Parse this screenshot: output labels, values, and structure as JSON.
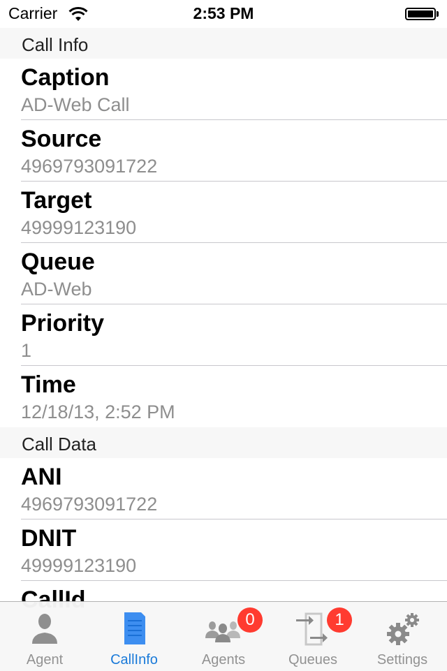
{
  "status_bar": {
    "carrier": "Carrier",
    "time": "2:53 PM",
    "wifi_icon": "wifi-icon",
    "battery_icon": "battery-icon",
    "battery_level": 1.0
  },
  "sections": [
    {
      "header": "Call Info",
      "rows": [
        {
          "title": "Caption",
          "value": "AD-Web Call"
        },
        {
          "title": "Source",
          "value": "4969793091722"
        },
        {
          "title": "Target",
          "value": "49999123190"
        },
        {
          "title": "Queue",
          "value": "AD-Web"
        },
        {
          "title": "Priority",
          "value": "1"
        },
        {
          "title": "Time",
          "value": "12/18/13, 2:52 PM"
        }
      ]
    },
    {
      "header": "Call Data",
      "rows": [
        {
          "title": "ANI",
          "value": "4969793091722"
        },
        {
          "title": "DNIT",
          "value": "49999123190"
        },
        {
          "title": "CallId",
          "value": ""
        }
      ]
    }
  ],
  "tab_bar": {
    "active": "CallInfo",
    "accent_color": "#1a7ad9",
    "tabs": [
      {
        "label": "Agent",
        "icon": "person-icon",
        "badge": null
      },
      {
        "label": "CallInfo",
        "icon": "document-icon",
        "badge": null
      },
      {
        "label": "Agents",
        "icon": "people-icon",
        "badge": "0"
      },
      {
        "label": "Queues",
        "icon": "queue-arrows-icon",
        "badge": "1"
      },
      {
        "label": "Settings",
        "icon": "gears-icon",
        "badge": null
      }
    ]
  }
}
